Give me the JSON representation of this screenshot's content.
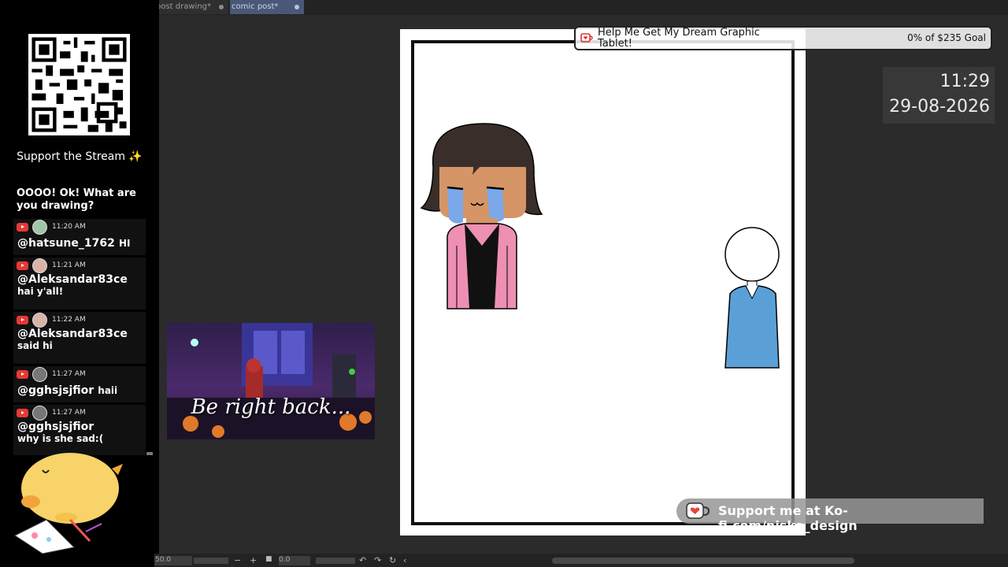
{
  "tabs": [
    {
      "label": "post drawing*"
    },
    {
      "label": "comic post*"
    }
  ],
  "sidebar": {
    "support_title": "Support the Stream ✨"
  },
  "chat": {
    "partial_top": "OOOO! Ok! What are you drawing?",
    "messages": [
      {
        "time": "11:20 AM",
        "user": "@hatsune_1762",
        "text": "HI",
        "inline": true
      },
      {
        "time": "11:21 AM",
        "user": "@Aleksandar83ce",
        "text": "hai y'all!",
        "inline": false
      },
      {
        "time": "11:22 AM",
        "user": "@Aleksandar83ce",
        "text": "said hi",
        "inline": false
      },
      {
        "time": "11:27 AM",
        "user": "@gghsjsjfior",
        "text": "haii",
        "inline": true
      },
      {
        "time": "11:27 AM",
        "user": "@gghsjsjfior",
        "text": "why is she sad:(",
        "inline": false
      }
    ]
  },
  "brb": {
    "text": "Be right back..."
  },
  "goal": {
    "title": "Help Me Get My Dream Graphic Tablet!",
    "amount": "0% of $235 Goal"
  },
  "clock": {
    "time": "11:29",
    "date": "29-08-2026"
  },
  "kofi": {
    "text": "Support me at Ko-fi.com/nisko_design"
  },
  "statusbar": {
    "zoom": "50.0",
    "rotation": "0.0"
  },
  "colors": {
    "accent_tab": "#4a5878",
    "cardigan": "#ee8fb4",
    "shirt": "#5aa0d6",
    "tears": "#7aa8e8"
  }
}
